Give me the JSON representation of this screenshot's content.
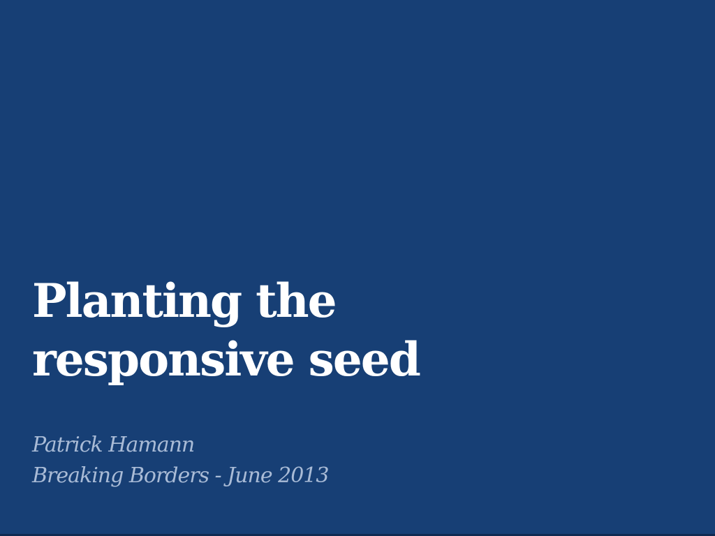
{
  "slide": {
    "title_lines": [
      "Planting the",
      "responsive seed"
    ],
    "author": "Patrick Hamann",
    "event": "Breaking Borders - June 2013"
  },
  "colors": {
    "background": "#173f75",
    "title": "#ffffff",
    "subtitle": "#a9bbd6"
  }
}
